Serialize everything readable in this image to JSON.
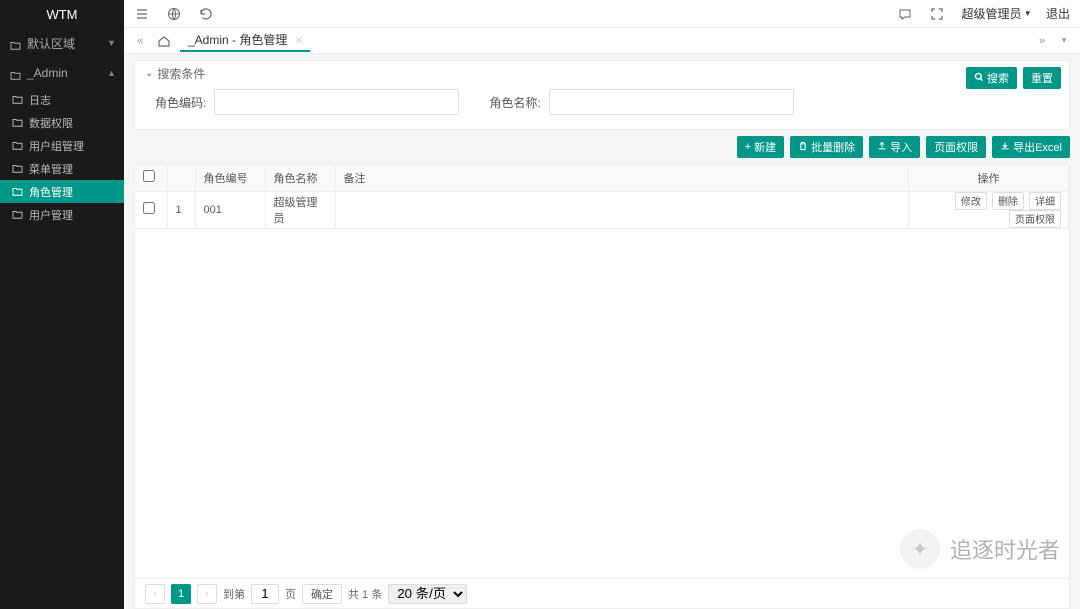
{
  "app": {
    "name": "WTM"
  },
  "sidebar": {
    "groups": [
      {
        "label": "默认区域",
        "expanded": false
      },
      {
        "label": "_Admin",
        "expanded": true
      }
    ],
    "items": [
      {
        "label": "日志"
      },
      {
        "label": "数据权限"
      },
      {
        "label": "用户组管理"
      },
      {
        "label": "菜单管理"
      },
      {
        "label": "角色管理"
      },
      {
        "label": "用户管理"
      }
    ]
  },
  "topbar": {
    "user": "超级管理员",
    "logout": "退出"
  },
  "tab": {
    "title": "_Admin - 角色管理"
  },
  "search": {
    "title": "搜索条件",
    "code_label": "角色编码:",
    "name_label": "角色名称:",
    "search_btn": "搜索",
    "reset_btn": "重置"
  },
  "actions": {
    "add": "新建",
    "batch_delete": "批量删除",
    "import": "导入",
    "page_perm": "页面权限",
    "export": "导出Excel"
  },
  "table": {
    "headers": {
      "code": "角色编号",
      "name": "角色名称",
      "remark": "备注",
      "ops": "操作"
    },
    "rows": [
      {
        "idx": "1",
        "code": "001",
        "name": "超级管理员",
        "remark": ""
      }
    ],
    "row_btns": {
      "edit": "修改",
      "delete": "删除",
      "detail": "详细",
      "page_perm": "页面权限"
    }
  },
  "pager": {
    "current": "1",
    "goto_label": "到第",
    "goto_value": "1",
    "page_unit": "页",
    "confirm": "确定",
    "total": "共 1 条",
    "page_size": "20 条/页"
  },
  "watermark": "追逐时光者"
}
